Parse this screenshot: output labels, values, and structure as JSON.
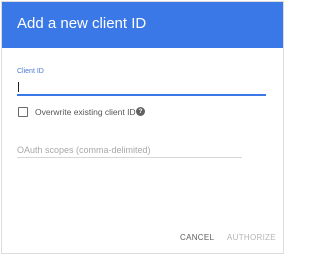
{
  "dialog": {
    "title": "Add a new client ID"
  },
  "client_id_field": {
    "label": "Client ID",
    "value": "",
    "placeholder": ""
  },
  "overwrite_checkbox": {
    "label": "Overwrite existing client ID",
    "checked": false,
    "help_icon_glyph": "?"
  },
  "scopes_field": {
    "value": "",
    "placeholder": "OAuth scopes (comma-delimited)"
  },
  "actions": {
    "cancel_label": "CANCEL",
    "authorize_label": "AUTHORIZE"
  },
  "colors": {
    "header": "#3b78e7",
    "accent": "#3b78e7",
    "disabled_text": "#b5b5b5"
  }
}
